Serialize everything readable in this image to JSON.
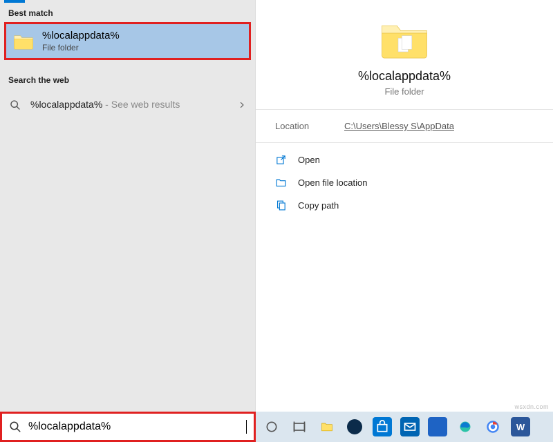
{
  "left": {
    "best_match_header": "Best match",
    "best_match": {
      "title": "%localappdata%",
      "subtitle": "File folder"
    },
    "web_header": "Search the web",
    "web_item": {
      "term": "%localappdata%",
      "hint": " - See web results"
    }
  },
  "preview": {
    "title": "%localappdata%",
    "type": "File folder",
    "location_label": "Location",
    "location_path": "C:\\Users\\Blessy S\\AppData"
  },
  "actions": {
    "open": "Open",
    "open_location": "Open file location",
    "copy_path": "Copy path"
  },
  "search": {
    "value": "%localappdata%"
  },
  "colors": {
    "accent": "#0078d4",
    "selected_bg": "#a7c7e7",
    "highlight_border": "#e02020",
    "folder_light": "#fff0b3",
    "folder_dark": "#f0c419"
  },
  "watermark": "wsxdn.com"
}
